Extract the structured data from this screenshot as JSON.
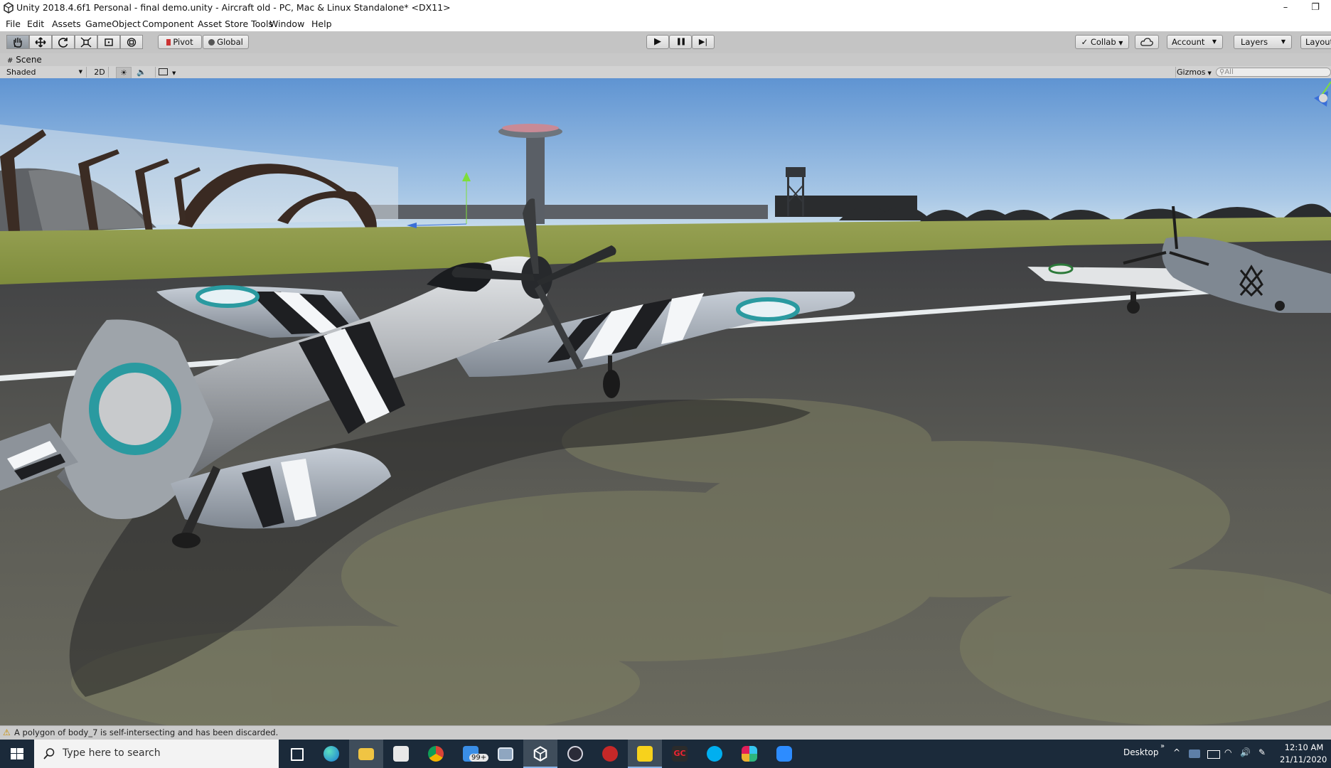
{
  "window": {
    "title": "Unity 2018.4.6f1 Personal - final demo.unity - Aircraft old - PC, Mac & Linux Standalone* <DX11>",
    "minimize_glyph": "–",
    "restore_glyph": "❐"
  },
  "menus": [
    "File",
    "Edit",
    "Assets",
    "GameObject",
    "Component",
    "Asset Store Tools",
    "Window",
    "Help"
  ],
  "toolbar": {
    "tools": [
      "hand-tool",
      "move-tool",
      "rotate-tool",
      "scale-tool",
      "rect-tool",
      "transform-tool"
    ],
    "pivot_label": "Pivot",
    "global_label": "Global",
    "play_glyph": "▶",
    "pause_glyph": "❚❚",
    "step_glyph": "▶|",
    "collab_label": "Collab",
    "account_label": "Account",
    "layers_label": "Layers",
    "layout_label": "Layout"
  },
  "scene_tab": {
    "label": "Scene",
    "shading_mode": "Shaded",
    "mode_2d": "2D",
    "gizmos_label": "Gizmos",
    "search_placeholder": "All"
  },
  "status": {
    "message": "A polygon of body_7 is self-intersecting and has been discarded."
  },
  "taskbar": {
    "search_placeholder": "Type here to search",
    "desktop_label": "Desktop",
    "time": "12:10 AM",
    "date": "21/11/2020",
    "mail_badge": "99+",
    "apps": [
      "task-view",
      "edge",
      "file-explorer",
      "store",
      "chrome",
      "mail",
      "rdp",
      "unity",
      "obs",
      "sourcetree",
      "sticky-notes",
      "gamecomp",
      "skype",
      "slack",
      "zoom"
    ]
  },
  "colors": {
    "accent": "#2a7bd6",
    "roundel_teal": "#2a9aa0",
    "sky_top": "#6a9ed6",
    "sky_horizon": "#d8e8f2"
  }
}
